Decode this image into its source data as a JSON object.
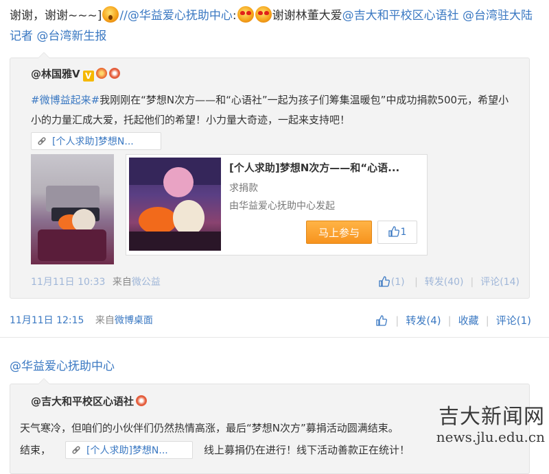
{
  "post1": {
    "text_part1": "谢谢，谢谢~~~]",
    "text_part2": "//",
    "mention_huayi": "@华益爱心抚助中心",
    "text_colon": ":",
    "text_part3": "谢谢林董大爱",
    "mention_jida": "@吉大和平校区心语社",
    "mention_taiwan_reporter": "@台湾驻大陆记者",
    "mention_taiwan_news": "@台湾新生报",
    "meta": {
      "time": "11月11日 12:15",
      "source_prefix": "来自",
      "source": "微博桌面"
    },
    "actions": {
      "forward": "转发(4)",
      "favorite": "收藏",
      "comment": "评论(1)"
    }
  },
  "quoted1": {
    "author": "@林国雅V",
    "hashtag": "#微博益起来#",
    "text": "我刚刚在“梦想N次方——和“心语社”一起为孩子们筹集温暖包”中成功捐款500元，希望小小的力量汇成大爱，托起他们的希望！小力量大奇迹，一起来支持吧！",
    "link_chip": "[个人求助]梦想N...",
    "card": {
      "title": "[个人求助]梦想N次方——和“心语...",
      "type": "求捐款",
      "initiator": "由华益爱心抚助中心发起",
      "join_button": "马上参与",
      "like_count": "1"
    },
    "meta": {
      "time": "11月11日 10:33",
      "source_prefix": "来自",
      "source": "微公益"
    },
    "actions": {
      "like": "(1)",
      "forward": "转发(40)",
      "comment": "评论(14)"
    }
  },
  "post2": {
    "author": "@华益爱心抚助中心"
  },
  "quoted2": {
    "author": "@吉大和平校区心语社",
    "line1": "天气寒冷，但咱们的小伙伴们仍然热情高涨，最后“梦想N次方”募捐活动圆满结束",
    "line1_tail": "。",
    "line2_start": "结束，",
    "link_chip": "[个人求助]梦想N...",
    "line2_end": "线上募捐仍在进行！线下活动善款正在统计！"
  },
  "watermark": {
    "title": "吉大新闻网",
    "url": "news.jlu.edu.cn"
  },
  "colors": {
    "link": "#3a78c2",
    "join_button": "#f7931e",
    "quote_bg": "#f3f3f3"
  }
}
